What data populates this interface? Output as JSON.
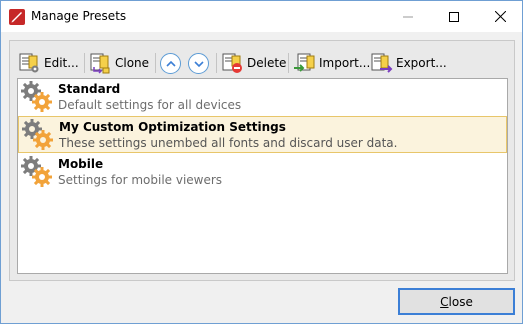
{
  "window": {
    "title": "Manage Presets",
    "controls": {
      "minimize": "minimize",
      "maximize": "maximize",
      "close": "close"
    }
  },
  "toolbar": {
    "edit_label": "Edit...",
    "clone_label": "Clone",
    "move_up": "move-up",
    "move_down": "move-down",
    "delete_label": "Delete",
    "import_label": "Import...",
    "export_label": "Export..."
  },
  "presets": [
    {
      "name": "Standard",
      "description": "Default settings for all devices",
      "selected": false
    },
    {
      "name": "My Custom Optimization Settings",
      "description": "These settings unembed all fonts and discard user data.",
      "selected": true
    },
    {
      "name": "Mobile",
      "description": "Settings for mobile viewers",
      "selected": false
    }
  ],
  "footer": {
    "close_label": "Close"
  },
  "colors": {
    "accent": "#3c7fd6",
    "selection_bg": "#fbf3dd",
    "selection_border": "#e8c66a",
    "gear_orange": "#f2a33a",
    "gear_gray": "#7d7d7d"
  }
}
